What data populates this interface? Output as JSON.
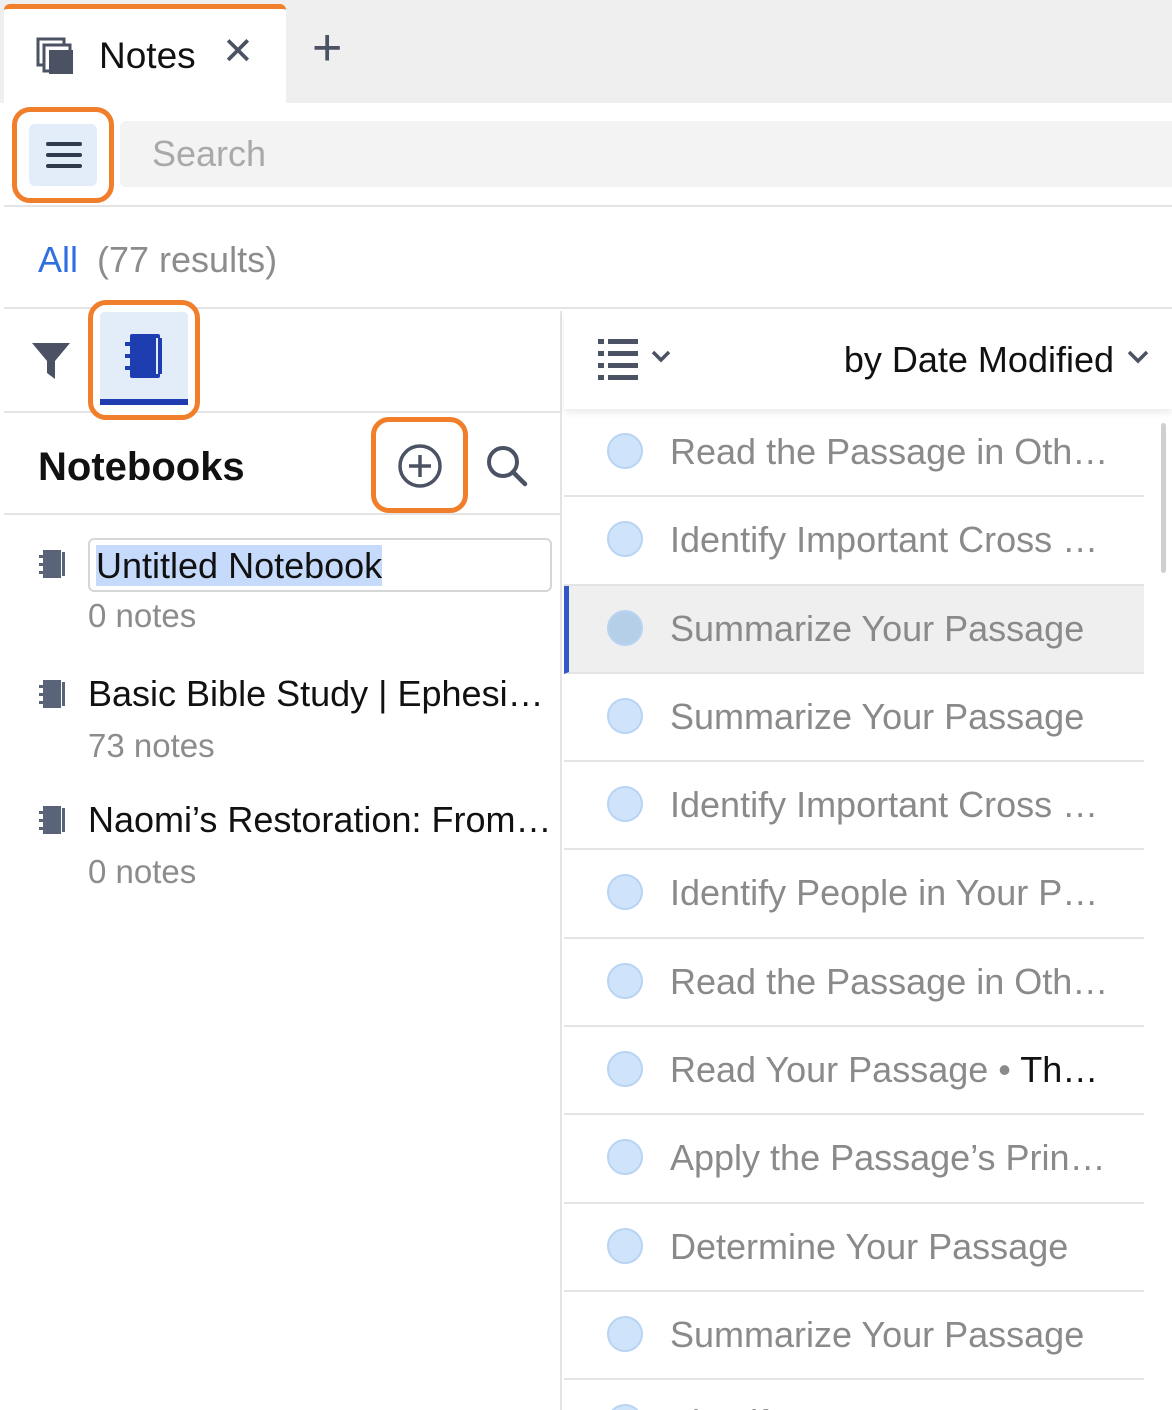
{
  "tab": {
    "title": "Notes",
    "close_glyph": "✕",
    "add_glyph": "+",
    "icon": "notes-stack-icon"
  },
  "search": {
    "placeholder": "Search",
    "value": ""
  },
  "results": {
    "filter_label": "All",
    "count_text": "(77 results)"
  },
  "notebooks_panel": {
    "title": "Notebooks",
    "icons": {
      "filter": "filter-icon",
      "notebook_tab": "notebook-icon",
      "add": "plus-circle-icon",
      "search": "search-icon"
    },
    "items": [
      {
        "name": "Untitled Notebook",
        "count": "0 notes",
        "editing": true
      },
      {
        "name": "Basic Bible Study | Ephesians",
        "count": "73 notes",
        "editing": false
      },
      {
        "name": "Naomi’s Restoration: From Bitterness to Blessing",
        "count": "0 notes",
        "editing": false
      }
    ]
  },
  "notes_panel": {
    "sort_label": "by Date Modified",
    "icons": {
      "view": "list-view-icon",
      "chevron": "chevron-down-icon"
    },
    "selected_index": 2,
    "notes": [
      {
        "title": "Read the Passage in Other Translations",
        "suffix": ""
      },
      {
        "title": "Identify Important Cross References",
        "suffix": ""
      },
      {
        "title": "Summarize Your Passage",
        "suffix": ""
      },
      {
        "title": "Summarize Your Passage",
        "suffix": ""
      },
      {
        "title": "Identify Important Cross References",
        "suffix": ""
      },
      {
        "title": "Identify People in Your Passage",
        "suffix": ""
      },
      {
        "title": "Read the Passage in Other Translations",
        "suffix": ""
      },
      {
        "title": "Read Your Passage • ",
        "suffix": "Th…"
      },
      {
        "title": "Apply the Passage’s Principles",
        "suffix": ""
      },
      {
        "title": "Determine Your Passage",
        "suffix": ""
      },
      {
        "title": "Summarize Your Passage",
        "suffix": ""
      },
      {
        "title": "Identify",
        "suffix": ""
      }
    ]
  },
  "colors": {
    "highlight": "#f07e2a",
    "link": "#2f6fe0",
    "selected_bar": "#3356c8",
    "notebook_icon": "#1e3db0",
    "dot": "#cfe4fb"
  }
}
